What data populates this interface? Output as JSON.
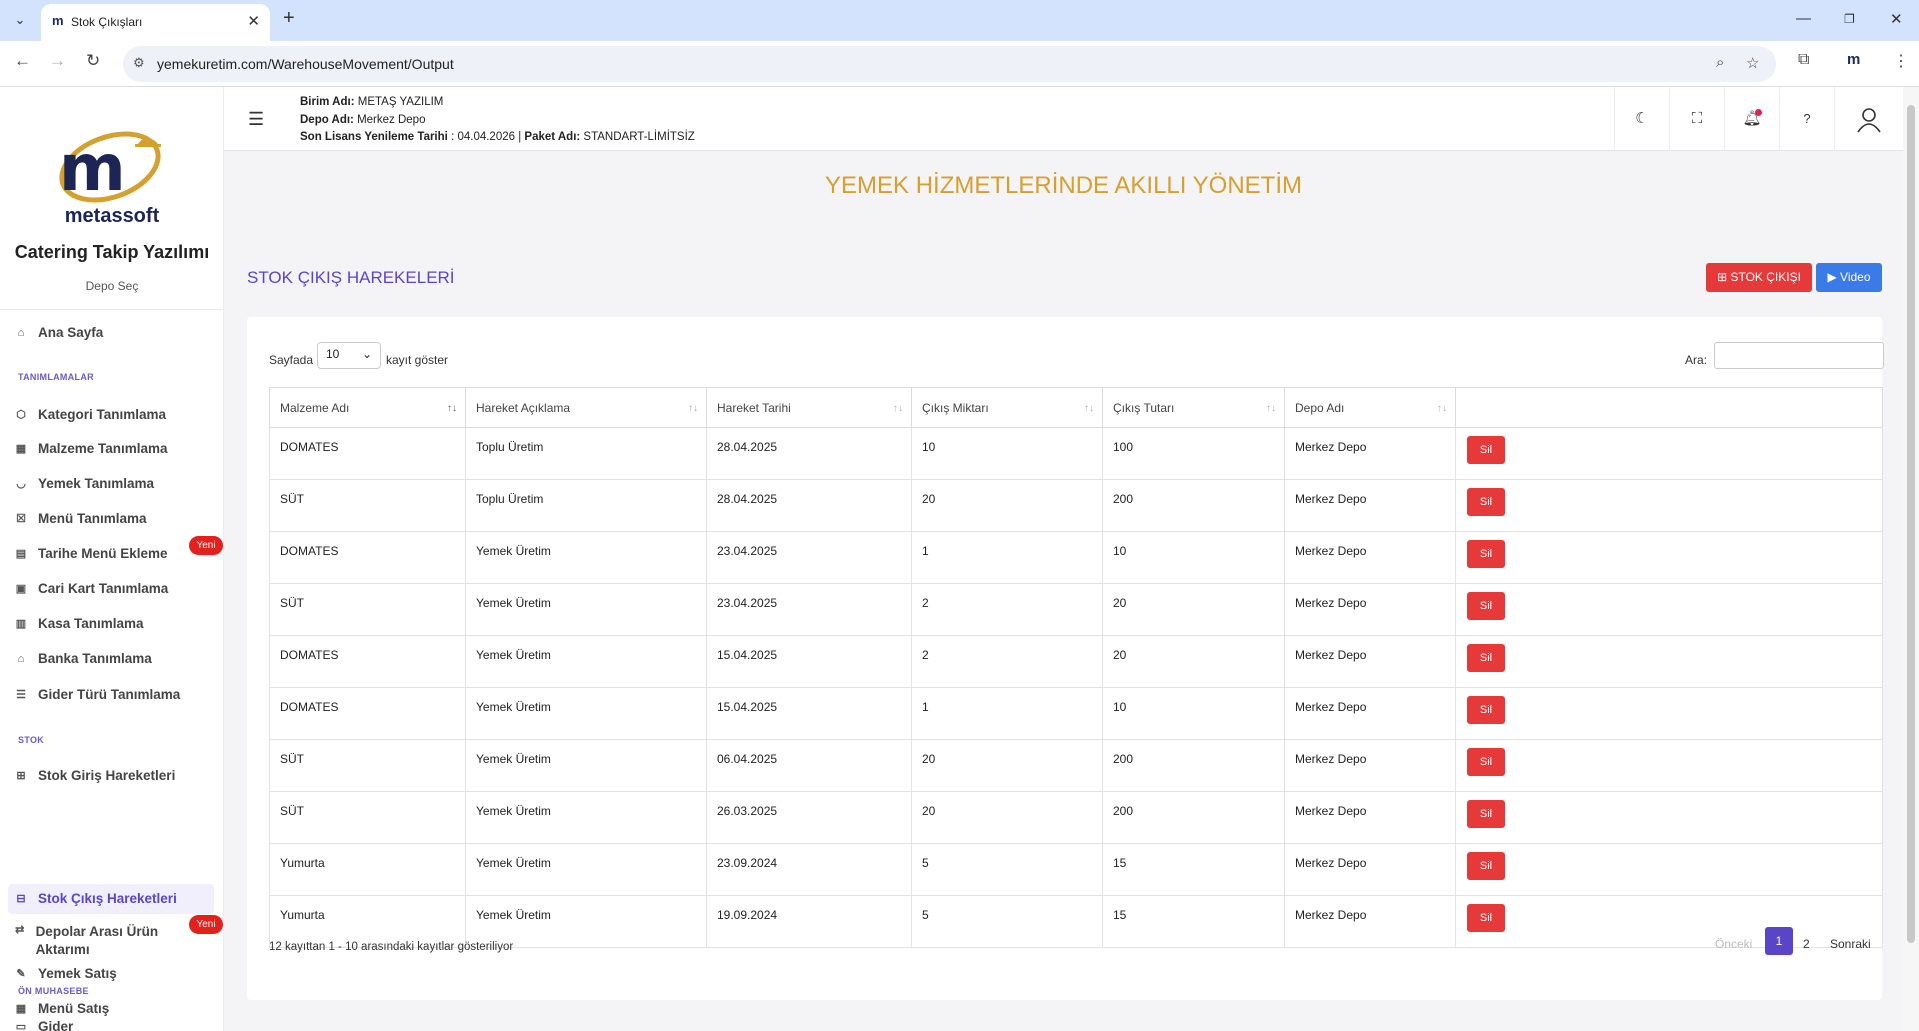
{
  "browser": {
    "tab_title": "Stok Çıkışları",
    "tab_icon": "m",
    "url": "yemekuretim.com/WarehouseMovement/Output",
    "ext_label": "m"
  },
  "sidebar": {
    "logo_text": "metassoft",
    "app_name": "Catering Takip Yazılımı",
    "depo_sec": "Depo Seç",
    "home": "Ana Sayfa",
    "sections": {
      "tanimlamalar": "TANIMLAMALAR",
      "stok": "STOK",
      "on_muhasebe": "ÖN MUHASEBE"
    },
    "items": {
      "kategori": "Kategori Tanımlama",
      "malzeme": "Malzeme Tanımlama",
      "yemek": "Yemek Tanımlama",
      "menu": "Menü Tanımlama",
      "tarihe_menu": "Tarihe Menü Ekleme",
      "cari_kart": "Cari Kart Tanımlama",
      "kasa": "Kasa Tanımlama",
      "banka": "Banka Tanımlama",
      "gider_turu": "Gider Türü Tanımlama",
      "stok_giris": "Stok Giriş Hareketleri",
      "stok_cikis": "Stok Çıkış Hareketleri",
      "depolar_arasi": "Depolar Arası Ürün Aktarımı",
      "gider": "Gider",
      "yemek_satis": "Yemek Satış",
      "menu_satis": "Menü Satış"
    },
    "badge_new": "Yeni"
  },
  "header": {
    "birim_label": "Birim Adı:",
    "birim_value": "METAŞ YAZILIM",
    "depo_label": "Depo Adı:",
    "depo_value": "Merkez Depo",
    "lisans_label": "Son Lisans Yenileme Tarihi",
    "lisans_value": ": 04.04.2026 |",
    "paket_label": "Paket Adı:",
    "paket_value": "STANDART-LİMİTSİZ"
  },
  "main": {
    "banner": "YEMEK HİZMETLERİNDE AKILLI YÖNETİM",
    "page_title": "STOK ÇIKIŞ HAREKELERİ",
    "btn_stok_cikisi": "STOK ÇIKIŞI",
    "btn_video": "Video",
    "length_prefix": "Sayfada",
    "length_value": "10",
    "length_suffix": "kayıt göster",
    "search_label": "Ara:",
    "columns": [
      "Malzeme Adı",
      "Hareket Açıklama",
      "Hareket Tarihi",
      "Çıkış Miktarı",
      "Çıkış Tutarı",
      "Depo Adı",
      ""
    ],
    "delete_label": "Sil",
    "rows": [
      {
        "malzeme": "DOMATES",
        "aciklama": "Toplu Üretim",
        "tarih": "28.04.2025",
        "miktar": "10",
        "tutar": "100",
        "depo": "Merkez Depo"
      },
      {
        "malzeme": "SÜT",
        "aciklama": "Toplu Üretim",
        "tarih": "28.04.2025",
        "miktar": "20",
        "tutar": "200",
        "depo": "Merkez Depo"
      },
      {
        "malzeme": "DOMATES",
        "aciklama": "Yemek Üretim",
        "tarih": "23.04.2025",
        "miktar": "1",
        "tutar": "10",
        "depo": "Merkez Depo"
      },
      {
        "malzeme": "SÜT",
        "aciklama": "Yemek Üretim",
        "tarih": "23.04.2025",
        "miktar": "2",
        "tutar": "20",
        "depo": "Merkez Depo"
      },
      {
        "malzeme": "DOMATES",
        "aciklama": "Yemek Üretim",
        "tarih": "15.04.2025",
        "miktar": "2",
        "tutar": "20",
        "depo": "Merkez Depo"
      },
      {
        "malzeme": "DOMATES",
        "aciklama": "Yemek Üretim",
        "tarih": "15.04.2025",
        "miktar": "1",
        "tutar": "10",
        "depo": "Merkez Depo"
      },
      {
        "malzeme": "SÜT",
        "aciklama": "Yemek Üretim",
        "tarih": "06.04.2025",
        "miktar": "20",
        "tutar": "200",
        "depo": "Merkez Depo"
      },
      {
        "malzeme": "SÜT",
        "aciklama": "Yemek Üretim",
        "tarih": "26.03.2025",
        "miktar": "20",
        "tutar": "200",
        "depo": "Merkez Depo"
      },
      {
        "malzeme": "Yumurta",
        "aciklama": "Yemek Üretim",
        "tarih": "23.09.2024",
        "miktar": "5",
        "tutar": "15",
        "depo": "Merkez Depo"
      },
      {
        "malzeme": "Yumurta",
        "aciklama": "Yemek Üretim",
        "tarih": "19.09.2024",
        "miktar": "5",
        "tutar": "15",
        "depo": "Merkez Depo"
      }
    ],
    "info": "12 kayıttan 1 - 10 arasındaki kayıtlar gösteriliyor",
    "pagination": {
      "prev": "Önceki",
      "pages": [
        "1",
        "2"
      ],
      "next": "Sonraki"
    }
  }
}
